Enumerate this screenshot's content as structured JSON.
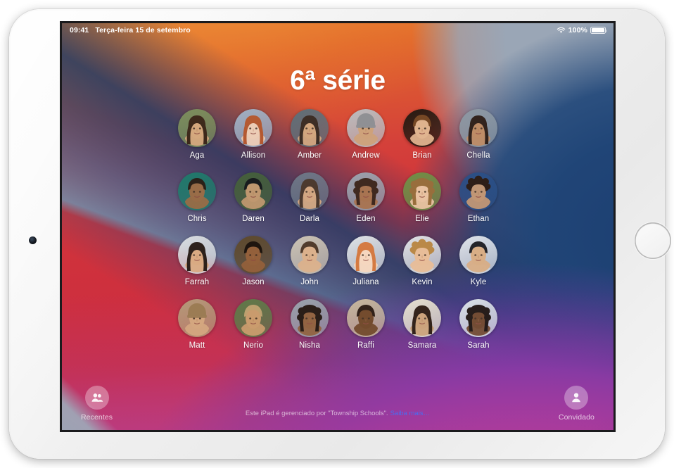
{
  "device": {
    "name": "iPad",
    "orientation": "landscape",
    "home_button": "home-button",
    "camera": "front-camera"
  },
  "status_bar": {
    "time": "09:41",
    "date": "Terça-feira 15 de setembro",
    "wifi_icon": "wifi-icon",
    "battery_percent": "100%",
    "battery_icon": "battery-full-icon"
  },
  "screen": {
    "title": "6ª série",
    "wallpaper": {
      "style": "ios14-abstract-gradient",
      "colors": {
        "orange": "#e8822f",
        "red": "#ce2f3e",
        "gray_blue": "#9aa6b6",
        "navy": "#1d3f72",
        "purple": "#7f3aa6",
        "magenta": "#b93d9e"
      }
    }
  },
  "users": [
    {
      "name": "Aga",
      "hair": "#3a2418",
      "skin": "#d9a97f",
      "bg": "#7c8f5c",
      "style": "girl-long"
    },
    {
      "name": "Allison",
      "hair": "#b5552a",
      "skin": "#f0cdb4",
      "bg": "#9fb0c4",
      "style": "girl-long"
    },
    {
      "name": "Amber",
      "hair": "#3b2a21",
      "skin": "#d8a97f",
      "bg": "#5d6f79",
      "style": "girl-long"
    },
    {
      "name": "Andrew",
      "hair": "#8d8d92",
      "skin": "#cfa077",
      "bg": "#b9bcc0",
      "style": "boy-hat"
    },
    {
      "name": "Brian",
      "hair": "#7a4b26",
      "skin": "#e9bb95",
      "bg": "#241a12",
      "style": "boy-short"
    },
    {
      "name": "Chella",
      "hair": "#2d1d16",
      "skin": "#c08b63",
      "bg": "#8c98a3",
      "style": "girl-long"
    },
    {
      "name": "Chris",
      "hair": "#2a1c14",
      "skin": "#9e6b45",
      "bg": "#1f7a6b",
      "style": "boy-short"
    },
    {
      "name": "Daren",
      "hair": "#16181c",
      "skin": "#c59a72",
      "bg": "#45603a",
      "style": "boy-short"
    },
    {
      "name": "Darla",
      "hair": "#4a362a",
      "skin": "#d7a982",
      "bg": "#6d7787",
      "style": "girl-long"
    },
    {
      "name": "Eden",
      "hair": "#3b2318",
      "skin": "#a9714c",
      "bg": "#9aa3ae",
      "style": "girl-curly"
    },
    {
      "name": "Elie",
      "hair": "#9a6c3c",
      "skin": "#eec4a6",
      "bg": "#6e8f46",
      "style": "girl-curly"
    },
    {
      "name": "Ethan",
      "hair": "#2e1c12",
      "skin": "#c89a74",
      "bg": "#2a4f86",
      "style": "boy-curly"
    },
    {
      "name": "Farrah",
      "hair": "#241812",
      "skin": "#d9a87e",
      "bg": "#d9dde0",
      "style": "girl-long"
    },
    {
      "name": "Jason",
      "hair": "#1a120d",
      "skin": "#96613c",
      "bg": "#5f4a2c",
      "style": "boy-short"
    },
    {
      "name": "John",
      "hair": "#4a3425",
      "skin": "#dcb08a",
      "bg": "#cdc4b4",
      "style": "boy-short"
    },
    {
      "name": "Juliana",
      "hair": "#d4753a",
      "skin": "#f6d6bd",
      "bg": "#dfe3e6",
      "style": "girl-long"
    },
    {
      "name": "Kevin",
      "hair": "#b8843f",
      "skin": "#e8bb94",
      "bg": "#dfe2e5",
      "style": "boy-curly"
    },
    {
      "name": "Kyle",
      "hair": "#191a1f",
      "skin": "#d8ab81",
      "bg": "#dfe4ea",
      "style": "boy-short"
    },
    {
      "name": "Matt",
      "hair": "#9a7a52",
      "skin": "#d5a77f",
      "bg": "#b49a79",
      "style": "boy-hat"
    },
    {
      "name": "Nerio",
      "hair": "#c2a271",
      "skin": "#cf9d6f",
      "bg": "#5e7a48",
      "style": "boy-short"
    },
    {
      "name": "Nisha",
      "hair": "#241710",
      "skin": "#91603c",
      "bg": "#9aa3ad",
      "style": "girl-curly"
    },
    {
      "name": "Raffi",
      "hair": "#2a1a12",
      "skin": "#6f4628",
      "bg": "#c8b69c",
      "style": "boy-short"
    },
    {
      "name": "Samara",
      "hair": "#2a1a12",
      "skin": "#caa078",
      "bg": "#e6e0cf",
      "style": "girl-long"
    },
    {
      "name": "Sarah",
      "hair": "#1d1310",
      "skin": "#6e452b",
      "bg": "#dbe2e7",
      "style": "girl-curly"
    }
  ],
  "bottom_bar": {
    "recents_label": "Recentes",
    "recents_icon": "two-people-icon",
    "guest_label": "Convidado",
    "guest_icon": "person-icon",
    "managed_text": "Este iPad é gerenciado por \"Township Schools\".",
    "learn_more_label": "Saiba mais…",
    "learn_more_color": "#4a6df0"
  }
}
